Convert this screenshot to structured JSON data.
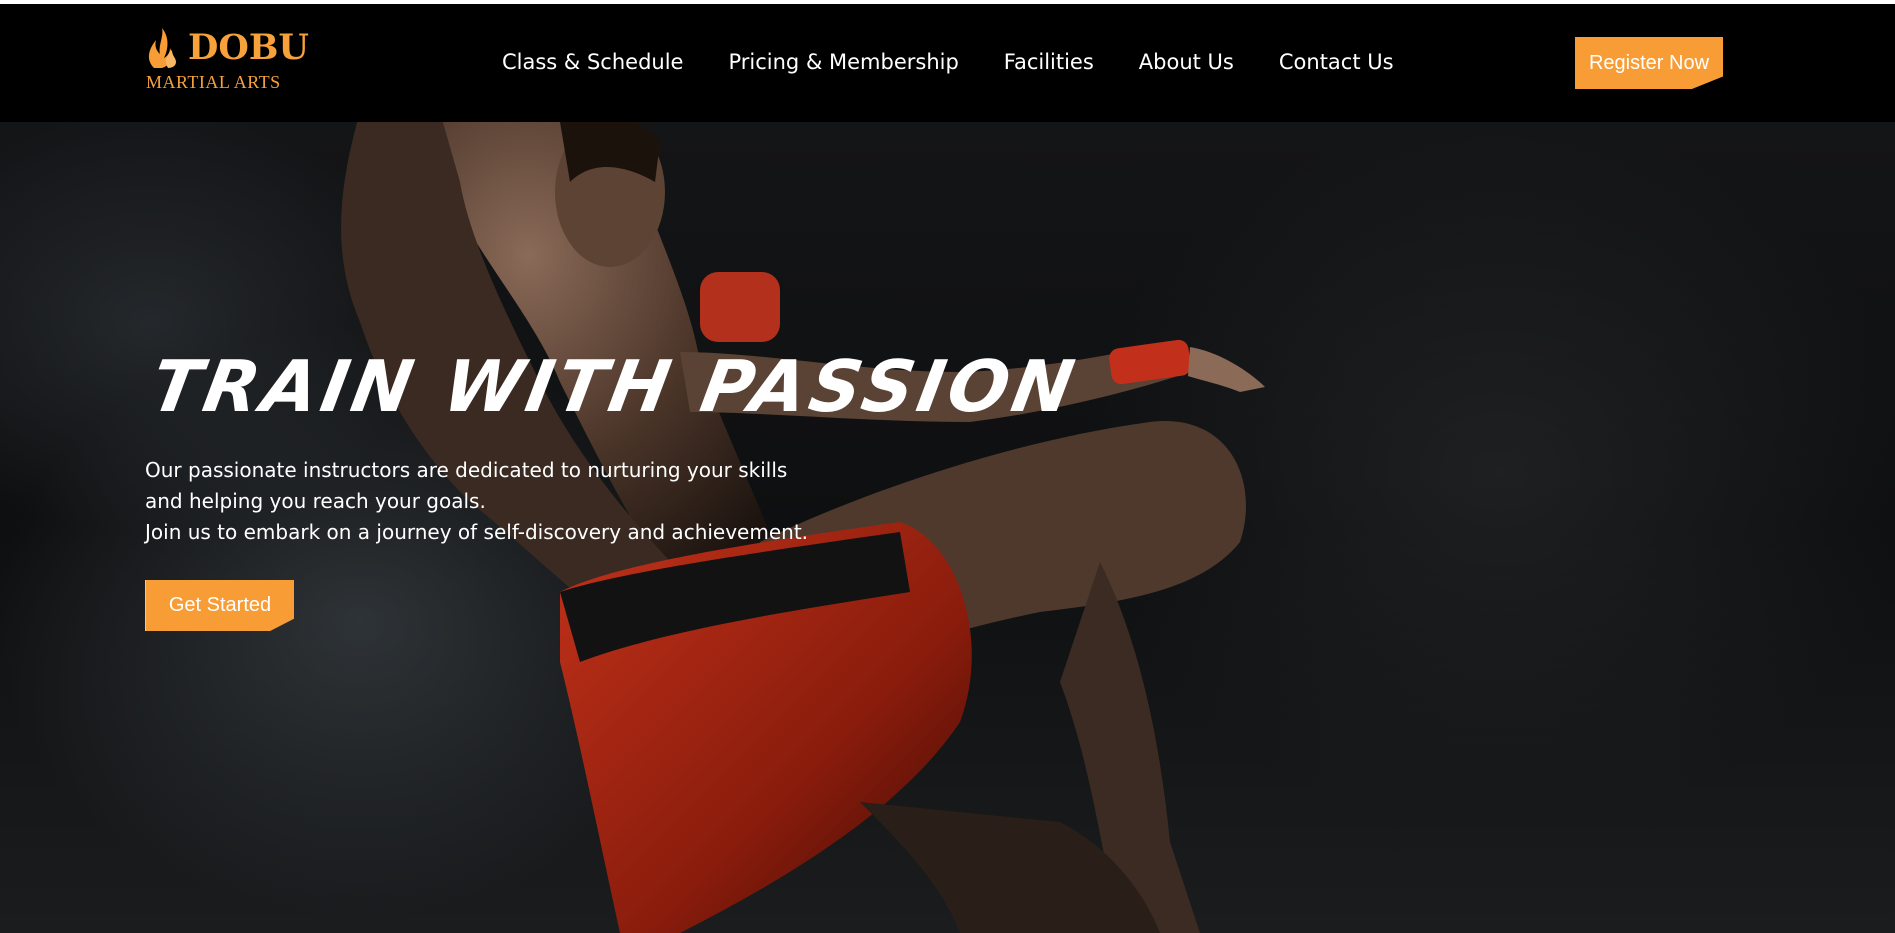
{
  "brand": {
    "name": "DOBU",
    "tagline": "MARTIAL ARTS",
    "icon": "flame-icon",
    "accent_color": "#f89c35"
  },
  "nav": {
    "items": [
      {
        "label": "Class & Schedule"
      },
      {
        "label": "Pricing & Membership"
      },
      {
        "label": "Facilities"
      },
      {
        "label": "About Us"
      },
      {
        "label": "Contact Us"
      }
    ],
    "register_label": "Register Now"
  },
  "hero": {
    "title": "TRAIN WITH PASSION",
    "description_lines": [
      "Our passionate instructors are dedicated to nurturing your skills",
      "and helping you reach your goals.",
      "Join us to embark on a journey of self-discovery and achievement."
    ],
    "cta_label": "Get Started",
    "image": "kickboxer-knee-strike-photo"
  }
}
